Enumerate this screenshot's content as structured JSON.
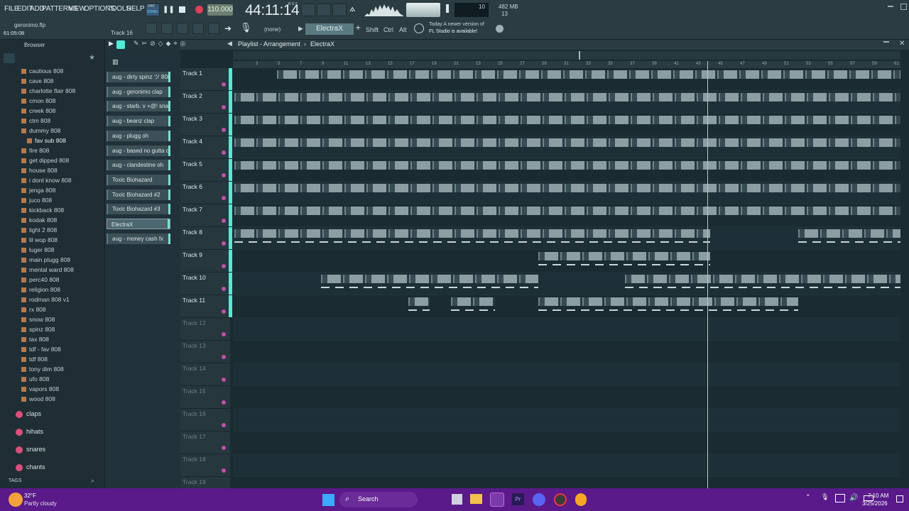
{
  "menu": [
    "FILE",
    "EDIT",
    "ADD",
    "PATTERNS",
    "VIEW",
    "OPTIONS",
    "TOOLS",
    "HELP"
  ],
  "project": {
    "file": "geronimo.flp",
    "time": "61:05:08",
    "track": "Track 16"
  },
  "transport": {
    "mode_top": "PAT",
    "mode_bottom": "SONG",
    "tempo": "110.000",
    "clock": "44:11:14",
    "clock_label": "B:S:T"
  },
  "cpu": {
    "mem": "482 MB",
    "poly": "13",
    "ten": "10"
  },
  "toolbar": {
    "pattern_select": "(none)",
    "pattern_name": "ElectraX",
    "shift": "Shift",
    "ctrl": "Ctrl",
    "alt": "Alt"
  },
  "news": {
    "line1": "Today  A newer version of",
    "line2": "FL Studio is available!"
  },
  "playlist": {
    "title": "Playlist - Arrangement",
    "separator": "›",
    "pattern": "ElectraX"
  },
  "browser": {
    "title": "Browser",
    "items": [
      "cautious 808",
      "cave 808",
      "charlotte flair 808",
      "cmon 808",
      "creek 808",
      "ctm 808",
      "dummy 808",
      "fav sub 808",
      "fire 808",
      "get dipped 808",
      "house 808",
      "i dont know 808",
      "jenga 808",
      "juco 808",
      "kickback 808",
      "kodak 808",
      "light 2 808",
      "lil wop 808",
      "luger 808",
      "main plugg 808",
      "mental ward 808",
      "perc40 808",
      "religion 808",
      "rodman 808 v1",
      "rx 808",
      "snow 808",
      "spinz 808",
      "tax 808",
      "tdf - fav 808",
      "tdf 808",
      "tony dim 808",
      "ufo 808",
      "vapors 808",
      "wood 808"
    ],
    "folders": [
      "claps",
      "hihats",
      "snares",
      "chants"
    ],
    "tags": "TAGS"
  },
  "channels": [
    "aug - dirty spinz ツ 808",
    "aug - geronimo clap",
    "aug - starb. v +@! snare",
    "aug - beanz clap",
    "aug - plugg oh",
    "aug - based no gutta oh",
    "aug - clandestine oh",
    "Toxic Biohazard",
    "Toxic Biohazard #2",
    "Toxic Biohazard #3",
    "ElectraX",
    "aug - money cash fx"
  ],
  "tracks": [
    "Track 1",
    "Track 2",
    "Track 3",
    "Track 4",
    "Track 5",
    "Track 6",
    "Track 7",
    "Track 8",
    "Track 9",
    "Track 10",
    "Track 11",
    "Track 12",
    "Track 13",
    "Track 14",
    "Track 15",
    "Track 16",
    "Track 17",
    "Track 18",
    "Track 19"
  ],
  "ruler": [
    "3",
    "5",
    "7",
    "9",
    "11",
    "13",
    "15",
    "17",
    "19",
    "21",
    "23",
    "25",
    "27",
    "29",
    "31",
    "33",
    "35",
    "37",
    "39",
    "41",
    "43",
    "45",
    "47",
    "49",
    "51",
    "53",
    "55",
    "57",
    "59",
    "61"
  ],
  "taskbar": {
    "temp": "32°F",
    "weather": "Partly cloudy",
    "search": "Search",
    "time": "7:10 AM",
    "date": "3/25/2026"
  }
}
